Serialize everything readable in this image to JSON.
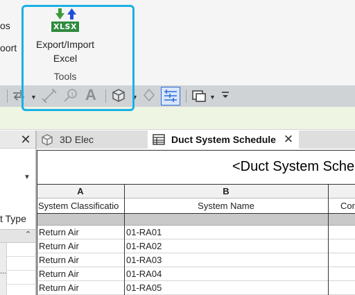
{
  "ribbon": {
    "left_cut_1": "os",
    "left_cut_2": "oort",
    "export_button": {
      "badge": "XLSX",
      "line1": "Export/Import",
      "line2": "Excel",
      "icon": "xlsx-icon",
      "badge_color": "#2e8b3e"
    },
    "panel_label": "Tools",
    "highlight_color": "#1ab0e6"
  },
  "toolbar": {
    "icons": [
      "align-icon",
      "dropdown-arrow-icon",
      "dimension-icon",
      "tag-icon",
      "text-icon",
      "3d-view-icon",
      "dropdown-arrow-icon",
      "section-icon",
      "thin-lines-icon",
      "switch-windows-icon",
      "dropdown-arrow-icon",
      "customize-icon"
    ],
    "text_glyph": "A",
    "active_color": "#2a6bd6"
  },
  "left_panel": {
    "close": "✕",
    "type_label": "t Type",
    "chevron": "⌃",
    "ellipsis": "..."
  },
  "tabs": [
    {
      "label": "3D Elec",
      "icon": "3d-cube-icon",
      "active": false
    },
    {
      "label": "Duct System Schedule",
      "icon": "schedule-icon",
      "active": true,
      "close": "✕"
    }
  ],
  "schedule": {
    "title": "<Duct System Sched",
    "column_letters": [
      "A",
      "B"
    ],
    "fields": [
      "System Classificatio",
      "System Name",
      "Cor"
    ],
    "rows": [
      {
        "classification": "Return Air",
        "name": "01-RA01"
      },
      {
        "classification": "Return Air",
        "name": "01-RA02"
      },
      {
        "classification": "Return Air",
        "name": "01-RA03"
      },
      {
        "classification": "Return Air",
        "name": "01-RA04"
      },
      {
        "classification": "Return Air",
        "name": "01-RA05"
      }
    ]
  }
}
